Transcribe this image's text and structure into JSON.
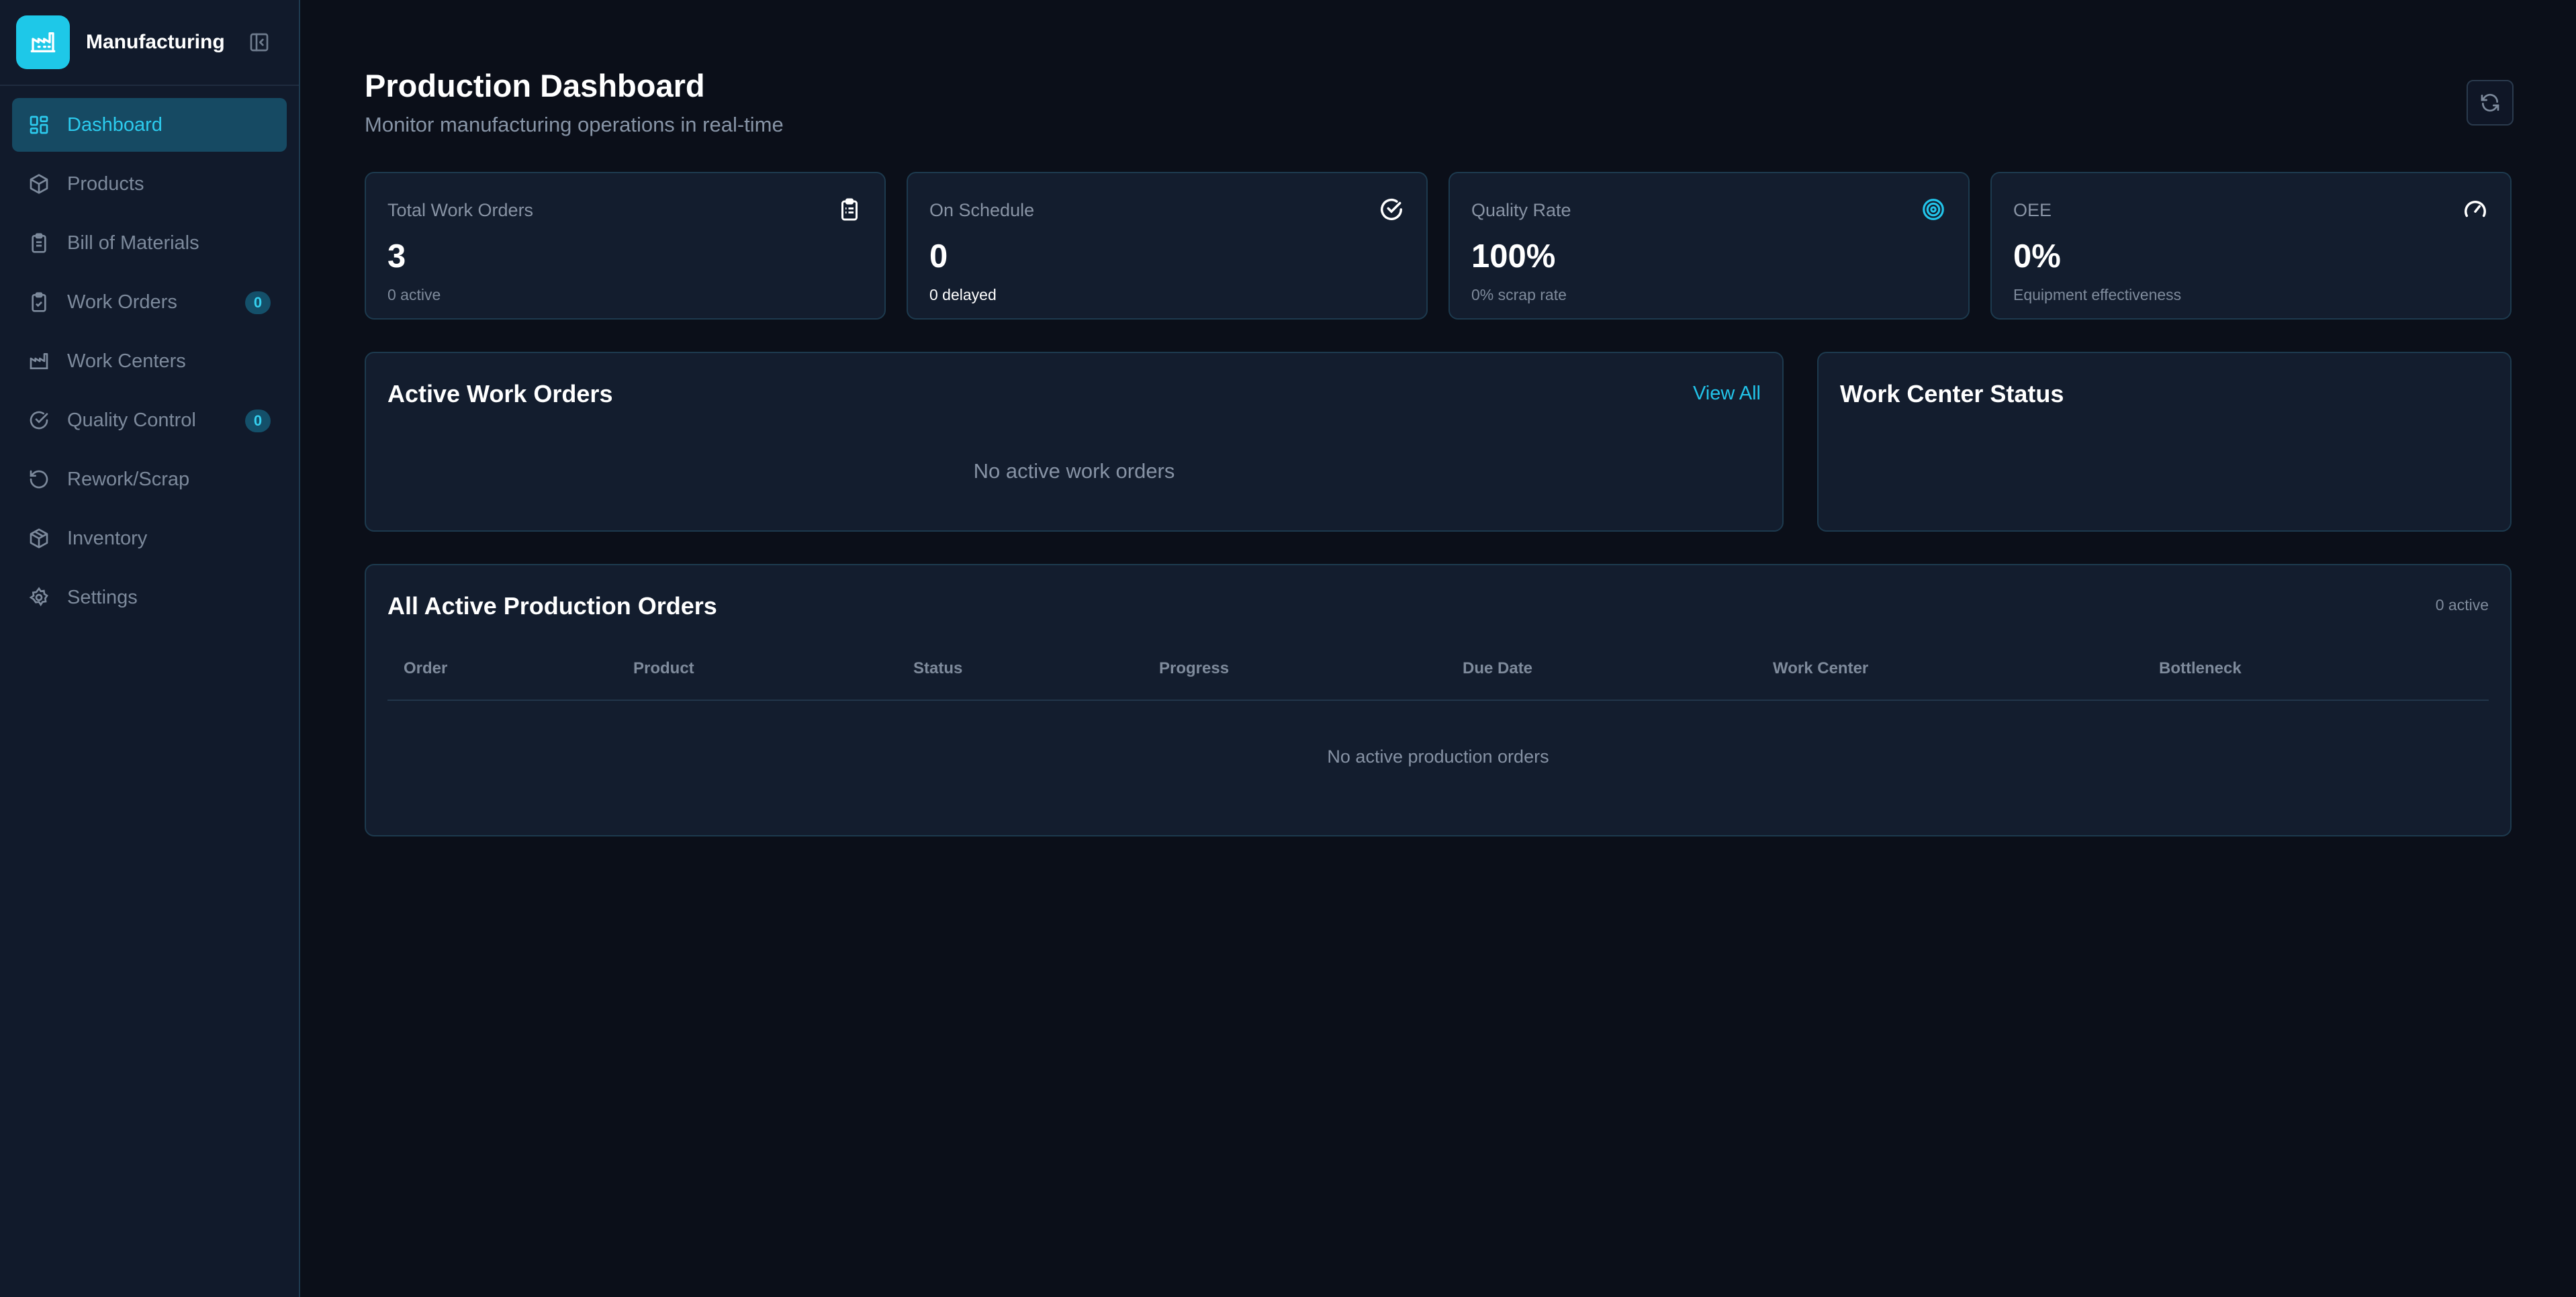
{
  "sidebar": {
    "brand_name": "Manufacturing",
    "items": [
      {
        "label": "Dashboard",
        "icon": "dashboard-icon",
        "active": true
      },
      {
        "label": "Products",
        "icon": "box-icon"
      },
      {
        "label": "Bill of Materials",
        "icon": "clipboard-icon"
      },
      {
        "label": "Work Orders",
        "icon": "clipboard-check-icon",
        "badge": "0"
      },
      {
        "label": "Work Centers",
        "icon": "factory-icon"
      },
      {
        "label": "Quality Control",
        "icon": "check-circle-icon",
        "badge": "0"
      },
      {
        "label": "Rework/Scrap",
        "icon": "rotate-ccw-icon"
      },
      {
        "label": "Inventory",
        "icon": "package-icon"
      },
      {
        "label": "Settings",
        "icon": "gear-icon"
      }
    ]
  },
  "header": {
    "title": "Production Dashboard",
    "subtitle": "Monitor manufacturing operations in real-time"
  },
  "stats": [
    {
      "label": "Total Work Orders",
      "value": "3",
      "sub": "0 active",
      "icon": "clipboard-list-icon"
    },
    {
      "label": "On Schedule",
      "value": "0",
      "sub": "0 delayed",
      "icon": "check-circle-icon"
    },
    {
      "label": "Quality Rate",
      "value": "100%",
      "sub": "0% scrap rate",
      "icon": "target-icon"
    },
    {
      "label": "OEE",
      "value": "0%",
      "sub": "Equipment effectiveness",
      "icon": "gauge-icon"
    }
  ],
  "active_work_orders": {
    "title": "Active Work Orders",
    "view_all": "View All",
    "empty": "No active work orders"
  },
  "work_center_status": {
    "title": "Work Center Status"
  },
  "production_orders": {
    "title": "All Active Production Orders",
    "count": "0 active",
    "columns": [
      "Order",
      "Product",
      "Status",
      "Progress",
      "Due Date",
      "Work Center",
      "Bottleneck"
    ],
    "empty": "No active production orders"
  },
  "colors": {
    "accent": "#22c4ea",
    "background": "#0b0f19",
    "card": "#131d2e"
  }
}
